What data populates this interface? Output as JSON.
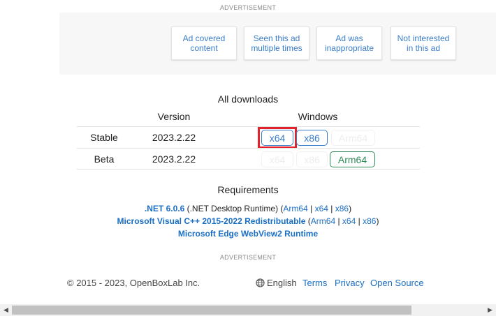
{
  "ad_top": {
    "label": "ADVERTISEMENT",
    "buttons": [
      "Ad covered content",
      "Seen this ad multiple times",
      "Ad was inappropriate",
      "Not interested in this ad"
    ]
  },
  "downloads": {
    "title": "All downloads",
    "col_version": "Version",
    "col_windows": "Windows",
    "rows": [
      {
        "channel": "Stable",
        "version": "2023.2.22",
        "buttons": [
          "x64",
          "x86",
          "Arm64"
        ]
      },
      {
        "channel": "Beta",
        "version": "2023.2.22",
        "buttons": [
          "x64",
          "x86",
          "Arm64"
        ]
      }
    ]
  },
  "requirements": {
    "title": "Requirements",
    "net_name": ".NET 6.0.6",
    "net_desc": " (.NET Desktop Runtime) (",
    "vc_name": "Microsoft Visual C++ 2015-2022 Redistributable",
    "edge_name": "Microsoft Edge WebView2 Runtime",
    "arch": [
      "Arm64",
      "x64",
      "x86"
    ],
    "sep": " | ",
    "open_paren": " (",
    "close_paren": ")"
  },
  "ad_bottom": {
    "label": "ADVERTISEMENT"
  },
  "footer": {
    "copyright": "© 2015 - 2023, OpenBoxLab Inc.",
    "language": "English",
    "links": [
      "Terms",
      "Privacy",
      "Open Source"
    ]
  },
  "scrollbar": {
    "left_arrow": "◀",
    "right_arrow": "▶"
  }
}
